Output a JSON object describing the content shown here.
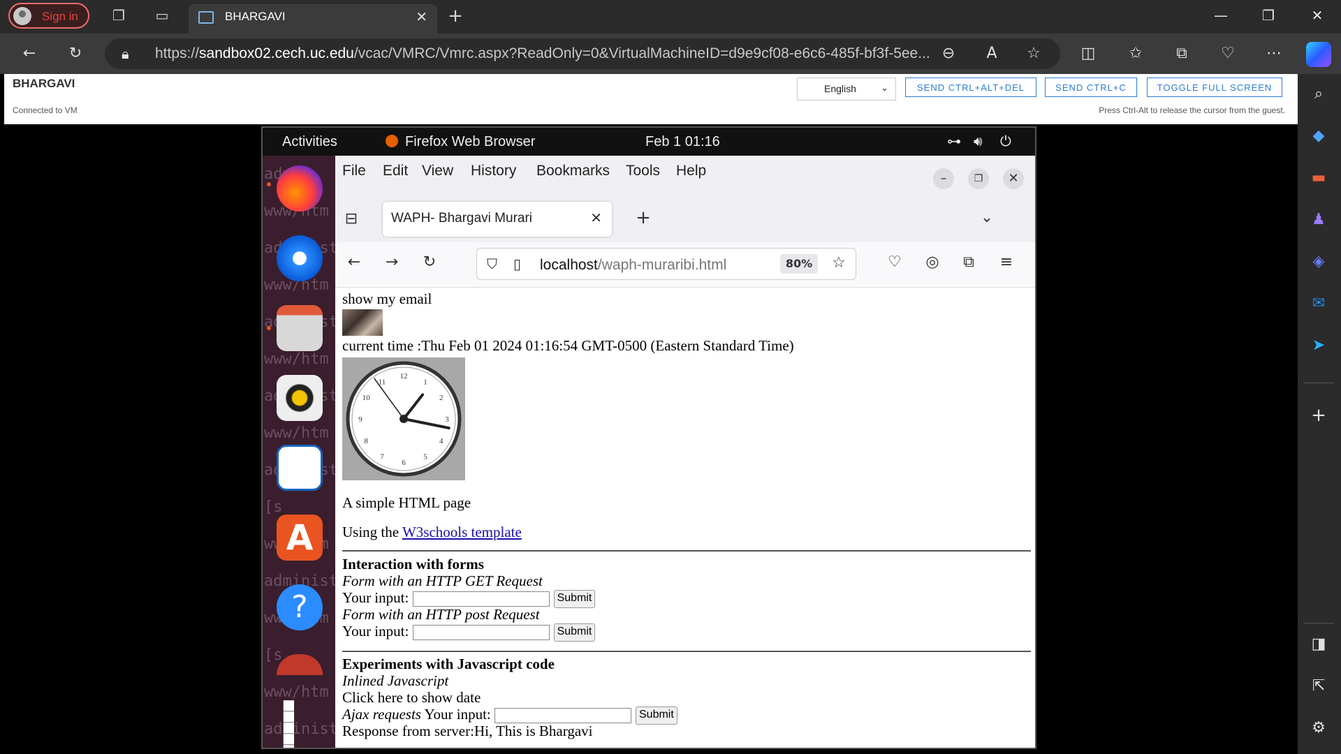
{
  "browser": {
    "signin_label": "Sign in",
    "tab_title": "BHARGAVI",
    "url_prefix": "https://",
    "url_host": "sandbox02.cech.uc.edu",
    "url_path": "/vcac/VMRC/Vmrc.aspx?ReadOnly=0&VirtualMachineID=d9e9cf08-e6c6-485f-bf3f-5ee..."
  },
  "vmrc": {
    "vm_name": "BHARGAVI",
    "status": "Connected to VM",
    "language": "English",
    "btn_ctrl_alt_del": "SEND CTRL+ALT+DEL",
    "btn_ctrl_c": "SEND CTRL+C",
    "btn_fullscreen": "TOGGLE FULL SCREEN",
    "hint": "Press Ctrl-Alt to release the cursor from the guest."
  },
  "ubuntu": {
    "activities": "Activities",
    "app_name": "Firefox Web Browser",
    "clock": "Feb 1  01:16",
    "terminal_text": "admin\nwww/htm\nadminist\nwww/htm\nadminist\nwww/htm\nadminist\nwww/htm\nadminist\n[s\nwww/htm\nadminist\nwww/htm\n[s\nwww/htm\nadminist\nwww/htm\nadminist"
  },
  "firefox": {
    "menu": [
      "File",
      "Edit",
      "View",
      "History",
      "Bookmarks",
      "Tools",
      "Help"
    ],
    "tab_title": "WAPH- Bhargavi Murari",
    "url_host": "localhost",
    "url_path": "/waph-muraribi.html",
    "zoom": "80%"
  },
  "page": {
    "show_email": "show my email",
    "current_time": "current time :Thu Feb 01 2024 01:16:54 GMT-0500 (Eastern Standard Time)",
    "clock_numbers": [
      "12",
      "1",
      "2",
      "3",
      "4",
      "5",
      "6",
      "7",
      "8",
      "9",
      "10",
      "11"
    ],
    "clock_time": {
      "hour": 1,
      "minute": 16,
      "second": 54
    },
    "simple_page": "A simple HTML page",
    "using_the": "Using the",
    "w3_link": "W3schools template",
    "forms_heading": "Interaction with forms",
    "get_label": "Form with an HTTP GET Request",
    "your_input": "Your input:",
    "submit": "Submit",
    "post_label": "Form with an HTTP post Request",
    "js_heading": "Experiments with Javascript code",
    "inlined_js": "Inlined Javascript",
    "click_date": "Click here to show date",
    "ajax_label": "Ajax requests",
    "response": "Response from server:Hi, This is Bhargavi"
  }
}
